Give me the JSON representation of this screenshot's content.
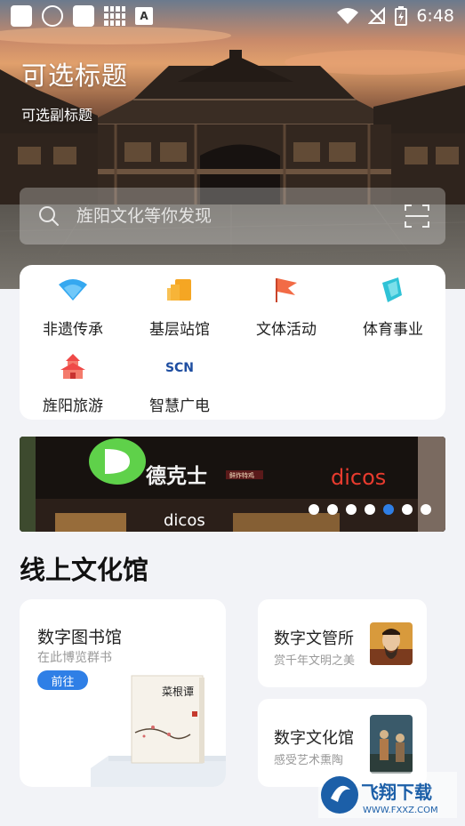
{
  "status_bar": {
    "time": "6:48"
  },
  "hero": {
    "title": "可选标题",
    "subtitle": "可选副标题",
    "search_placeholder": "旌阳文化等你发现"
  },
  "categories": [
    {
      "label": "非遗传承",
      "icon": "wifi-icon",
      "color": "#35a8f0"
    },
    {
      "label": "基层站馆",
      "icon": "building-icon",
      "color": "#f5a623"
    },
    {
      "label": "文体活动",
      "icon": "flag-icon",
      "color": "#f26b46"
    },
    {
      "label": "体育事业",
      "icon": "sports-icon",
      "color": "#2fc2d6"
    },
    {
      "label": "旌阳旅游",
      "icon": "pagoda-icon",
      "color": "#ef4a48"
    },
    {
      "label": "智慧广电",
      "icon": "scn-logo-icon",
      "color": "#1f4ea1"
    }
  ],
  "banner": {
    "sign_main": "德克士",
    "sign_tag": "鲜炸特鸡",
    "sign_brand": "dicos",
    "sign_lower": "dicos",
    "dots_total": 7,
    "dots_active_index": 4
  },
  "online": {
    "section_title": "线上文化馆",
    "library": {
      "title": "数字图书馆",
      "subtitle": "在此博览群书",
      "button": "前往",
      "book_title": "菜根谭"
    },
    "cards": [
      {
        "title": "数字文管所",
        "subtitle": "赏千年文明之美"
      },
      {
        "title": "数字文化馆",
        "subtitle": "感受艺术熏陶"
      }
    ]
  },
  "watermark": {
    "main": "飞翔下载",
    "url": "WWW.FXXZ.COM"
  },
  "colors": {
    "accent": "#2f7fe6",
    "background": "#f2f3f7"
  }
}
